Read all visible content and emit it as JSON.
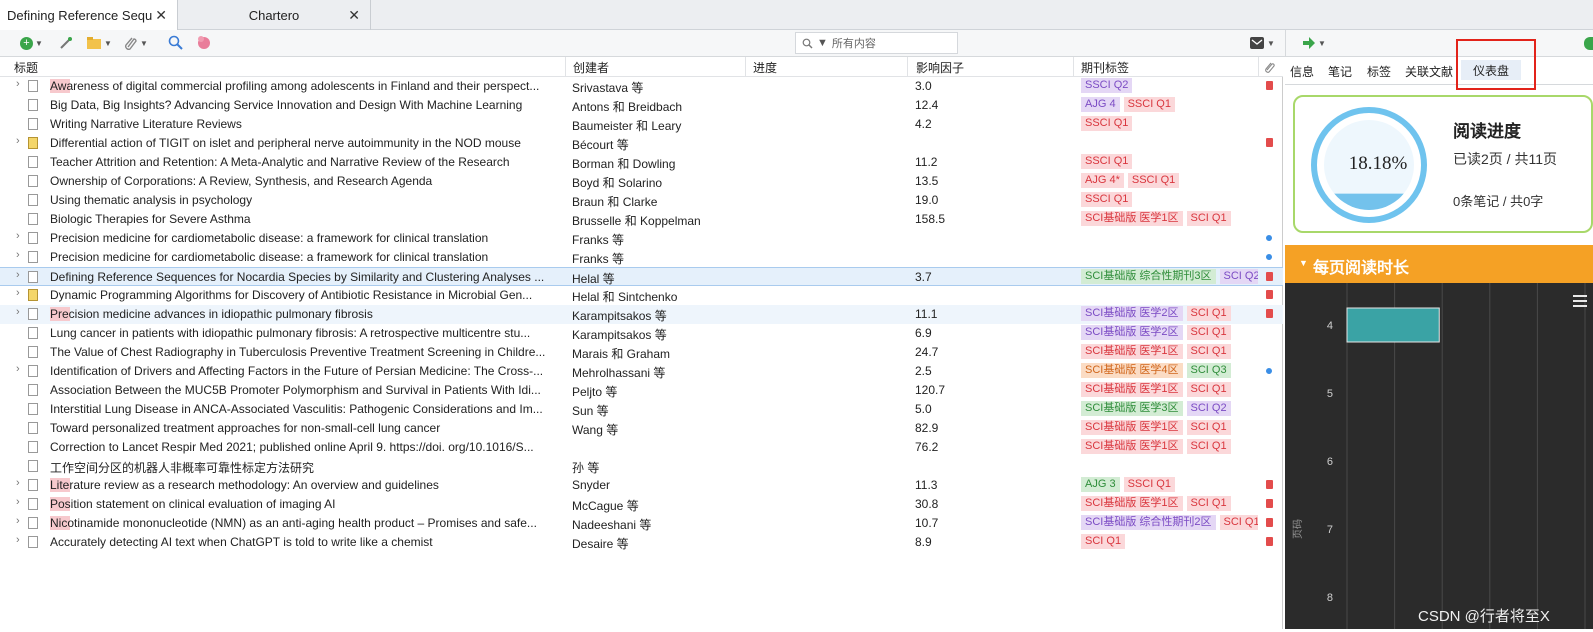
{
  "tabs": [
    {
      "label": "Defining Reference Sequ...",
      "active": true
    },
    {
      "label": "Chartero",
      "active": false
    }
  ],
  "toolbar": {
    "search_placeholder": "所有内容"
  },
  "columns": {
    "title": "标题",
    "creator": "创建者",
    "progress": "进度",
    "impact": "影响因子",
    "journal_tags": "期刊标签"
  },
  "rows": [
    {
      "title": "Awareness of digital commercial profiling among adolescents in Finland and their perspect...",
      "creator": "Srivastava 等",
      "impact": "3.0",
      "tags": [
        {
          "text": "SSCI Q2",
          "color": "purple"
        }
      ],
      "expand": true,
      "note": false,
      "att": "pdf",
      "hl": true
    },
    {
      "title": "Big Data, Big Insights? Advancing Service Innovation and Design With Machine Learning",
      "creator": "Antons 和 Breidbach",
      "impact": "12.4",
      "tags": [
        {
          "text": "AJG 4",
          "color": "purple"
        },
        {
          "text": "SSCI Q1",
          "color": "red"
        }
      ],
      "expand": false,
      "note": false,
      "att": ""
    },
    {
      "title": "Writing Narrative Literature Reviews",
      "creator": "Baumeister 和 Leary",
      "impact": "4.2",
      "tags": [
        {
          "text": "SSCI Q1",
          "color": "red"
        }
      ],
      "expand": false,
      "note": false,
      "att": ""
    },
    {
      "title": "Differential action of TIGIT on islet and peripheral nerve autoimmunity in the NOD mouse",
      "creator": "Bécourt 等",
      "impact": "",
      "tags": [],
      "expand": true,
      "note": true,
      "att": "pdf"
    },
    {
      "title": "Teacher Attrition and Retention: A Meta-Analytic and Narrative Review of the Research",
      "creator": "Borman 和 Dowling",
      "impact": "11.2",
      "tags": [
        {
          "text": "SSCI Q1",
          "color": "red"
        }
      ],
      "expand": false,
      "note": false,
      "att": ""
    },
    {
      "title": "Ownership of Corporations: A Review, Synthesis, and Research Agenda",
      "creator": "Boyd 和 Solarino",
      "impact": "13.5",
      "tags": [
        {
          "text": "AJG 4*",
          "color": "red"
        },
        {
          "text": "SSCI Q1",
          "color": "red"
        }
      ],
      "expand": false,
      "note": false,
      "att": ""
    },
    {
      "title": "Using thematic analysis in psychology",
      "creator": "Braun 和 Clarke",
      "impact": "19.0",
      "tags": [
        {
          "text": "SSCI Q1",
          "color": "red"
        }
      ],
      "expand": false,
      "note": false,
      "att": ""
    },
    {
      "title": "Biologic Therapies for Severe Asthma",
      "creator": "Brusselle 和 Koppelman",
      "impact": "158.5",
      "tags": [
        {
          "text": "SCI基础版 医学1区",
          "color": "red"
        },
        {
          "text": "SCI Q1",
          "color": "red"
        }
      ],
      "expand": false,
      "note": false,
      "att": ""
    },
    {
      "title": "Precision medicine for cardiometabolic disease: a framework for clinical translation",
      "creator": "Franks 等",
      "impact": "",
      "tags": [],
      "expand": true,
      "note": false,
      "att": "dot"
    },
    {
      "title": "Precision medicine for cardiometabolic disease: a framework for clinical translation",
      "creator": "Franks 等",
      "impact": "",
      "tags": [],
      "expand": true,
      "note": false,
      "att": "dot"
    },
    {
      "title": "Defining Reference Sequences for Nocardia Species by Similarity and Clustering Analyses ...",
      "creator": "Helal 等",
      "impact": "3.7",
      "tags": [
        {
          "text": "SCI基础版 综合性期刊3区",
          "color": "green"
        },
        {
          "text": "SCI Q2",
          "color": "purple"
        }
      ],
      "expand": true,
      "note": false,
      "att": "pdf",
      "sel": true
    },
    {
      "title": "Dynamic Programming Algorithms for Discovery of Antibiotic Resistance in Microbial Gen...",
      "creator": "Helal 和 Sintchenko",
      "impact": "",
      "tags": [],
      "expand": true,
      "note": true,
      "att": "pdf"
    },
    {
      "title": "Precision medicine advances in idiopathic pulmonary fibrosis",
      "creator": "Karampitsakos 等",
      "impact": "11.1",
      "tags": [
        {
          "text": "SCI基础版 医学2区",
          "color": "purple"
        },
        {
          "text": "SCI Q1",
          "color": "red"
        }
      ],
      "expand": true,
      "note": false,
      "att": "pdf",
      "hov": true,
      "hl": true
    },
    {
      "title": "Lung cancer in patients with idiopathic pulmonary fibrosis: A retrospective multicentre stu...",
      "creator": "Karampitsakos 等",
      "impact": "6.9",
      "tags": [
        {
          "text": "SCI基础版 医学2区",
          "color": "purple"
        },
        {
          "text": "SCI Q1",
          "color": "red"
        }
      ],
      "expand": false,
      "note": false,
      "att": ""
    },
    {
      "title": "The Value of Chest Radiography in Tuberculosis Preventive Treatment Screening in Childre...",
      "creator": "Marais 和 Graham",
      "impact": "24.7",
      "tags": [
        {
          "text": "SCI基础版 医学1区",
          "color": "red"
        },
        {
          "text": "SCI Q1",
          "color": "red"
        }
      ],
      "expand": false,
      "note": false,
      "att": ""
    },
    {
      "title": "Identification of Drivers and Affecting Factors in the Future of Persian Medicine: The Cross-...",
      "creator": "Mehrolhassani 等",
      "impact": "2.5",
      "tags": [
        {
          "text": "SCI基础版 医学4区",
          "color": "orange"
        },
        {
          "text": "SCI Q3",
          "color": "green"
        }
      ],
      "expand": true,
      "note": false,
      "att": "dot"
    },
    {
      "title": "Association Between the MUC5B Promoter Polymorphism and Survival in Patients With Idi...",
      "creator": "Peljto 等",
      "impact": "120.7",
      "tags": [
        {
          "text": "SCI基础版 医学1区",
          "color": "red"
        },
        {
          "text": "SCI Q1",
          "color": "red"
        }
      ],
      "expand": false,
      "note": false,
      "att": ""
    },
    {
      "title": "Interstitial Lung Disease in ANCA-Associated Vasculitis: Pathogenic Considerations and Im...",
      "creator": "Sun 等",
      "impact": "5.0",
      "tags": [
        {
          "text": "SCI基础版 医学3区",
          "color": "green"
        },
        {
          "text": "SCI Q2",
          "color": "purple"
        }
      ],
      "expand": false,
      "note": false,
      "att": ""
    },
    {
      "title": "Toward personalized treatment approaches for non-small-cell lung cancer",
      "creator": "Wang 等",
      "impact": "82.9",
      "tags": [
        {
          "text": "SCI基础版 医学1区",
          "color": "red"
        },
        {
          "text": "SCI Q1",
          "color": "red"
        }
      ],
      "expand": false,
      "note": false,
      "att": ""
    },
    {
      "title": "Correction to Lancet Respir Med 2021; published online April 9. https://doi. org/10.1016/S...",
      "creator": "",
      "impact": "76.2",
      "tags": [
        {
          "text": "SCI基础版 医学1区",
          "color": "red"
        },
        {
          "text": "SCI Q1",
          "color": "red"
        }
      ],
      "expand": false,
      "note": false,
      "att": ""
    },
    {
      "title": "工作空间分区的机器人非概率可靠性标定方法研究",
      "creator": "孙 等",
      "impact": "",
      "tags": [],
      "expand": false,
      "note": false,
      "att": ""
    },
    {
      "title": "Literature review as a research methodology: An overview and guidelines",
      "creator": "Snyder",
      "impact": "11.3",
      "tags": [
        {
          "text": "AJG 3",
          "color": "green"
        },
        {
          "text": "SSCI Q1",
          "color": "red"
        }
      ],
      "expand": true,
      "note": false,
      "att": "pdf",
      "hl": true
    },
    {
      "title": "Position statement on clinical evaluation of imaging AI",
      "creator": "McCague 等",
      "impact": "30.8",
      "tags": [
        {
          "text": "SCI基础版 医学1区",
          "color": "red"
        },
        {
          "text": "SCI Q1",
          "color": "red"
        }
      ],
      "expand": true,
      "note": false,
      "att": "pdf",
      "hl": true
    },
    {
      "title": "Nicotinamide mononucleotide (NMN) as an anti-aging health product – Promises and safe...",
      "creator": "Nadeeshani 等",
      "impact": "10.7",
      "tags": [
        {
          "text": "SCI基础版 综合性期刊2区",
          "color": "purple"
        },
        {
          "text": "SCI Q1",
          "color": "red"
        }
      ],
      "expand": true,
      "note": false,
      "att": "pdf",
      "hl": true
    },
    {
      "title": "Accurately detecting AI text when ChatGPT is told to write like a chemist",
      "creator": "Desaire 等",
      "impact": "8.9",
      "tags": [
        {
          "text": "SCI Q1",
          "color": "red"
        }
      ],
      "expand": true,
      "note": false,
      "att": "pdf"
    }
  ],
  "right_pane": {
    "tabs": [
      "信息",
      "笔记",
      "标签",
      "关联文献",
      "仪表盘"
    ],
    "progress_card": {
      "title": "阅读进度",
      "percent": "18.18%",
      "progress_fraction": 0.1818,
      "pages": "已读2页 / 共11页",
      "notes": "0条笔记 / 共0字"
    },
    "time_panel": {
      "title": "每页阅读时长",
      "y_axis_label": "页码"
    }
  },
  "chart_data": {
    "type": "bar",
    "orientation": "horizontal",
    "title": "每页阅读时长",
    "ylabel": "页码",
    "categories": [
      "4",
      "5",
      "6",
      "7",
      "8"
    ],
    "values": [
      1,
      0,
      0,
      0,
      0
    ],
    "grid": true
  },
  "watermark": "CSDN @行者将至X",
  "colors": {
    "accent_orange": "#f5a125",
    "progress_blue": "#52b7ea",
    "card_border": "#a8d86a",
    "bar_teal": "#3aa3a5",
    "selected_row": "#e5f0fb",
    "highlight_red": "#e2231a"
  }
}
